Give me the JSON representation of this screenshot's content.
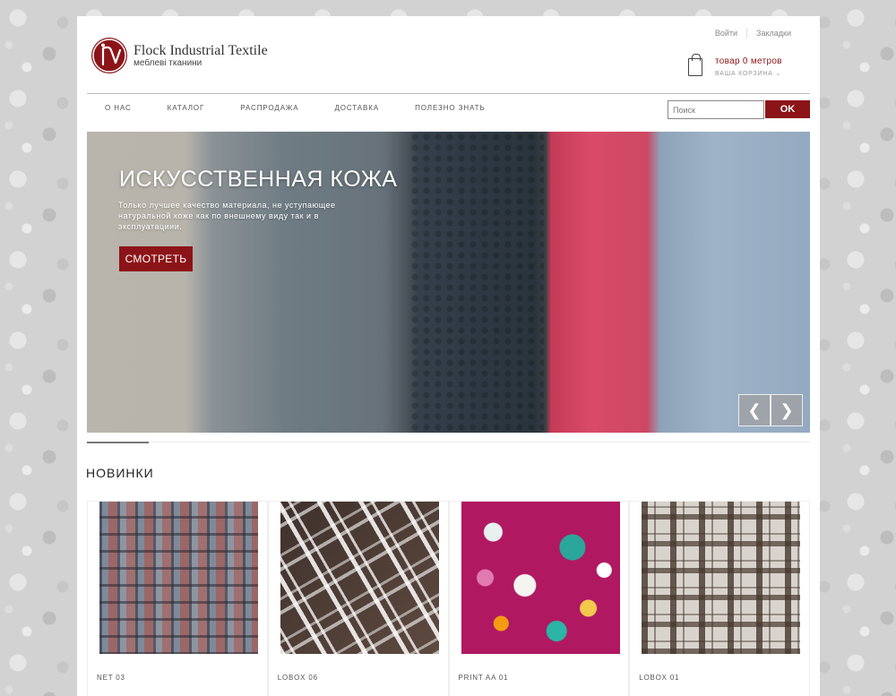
{
  "header": {
    "brand_name": "Flock Industrial Textile",
    "brand_sub": "меблеві тканини",
    "top_links": [
      "Войти",
      "Закладки"
    ],
    "cart": {
      "title": "товар 0 метров",
      "subtitle": "ВАША КОРЗИНА"
    }
  },
  "nav": {
    "items": [
      "О НАС",
      "КАТАЛОГ",
      "РАСПРОДАЖА",
      "ДОСТАВКА",
      "ПОЛЕЗНО ЗНАТЬ"
    ]
  },
  "search": {
    "placeholder": "Поиск",
    "button": "OK"
  },
  "banner": {
    "title": "ИСКУССТВЕННАЯ КОЖА",
    "text": "Только лучшее качество материала, не уступающее натуральной коже как по внешнему виду так и в эксплуатациии.",
    "button": "СМОТРЕТЬ"
  },
  "section": {
    "title": "НОВИНКИ"
  },
  "products": [
    {
      "name": "NET 03"
    },
    {
      "name": "LOBOX 06"
    },
    {
      "name": "PRINT AA 01"
    },
    {
      "name": "LOBOX 01"
    }
  ],
  "colors": {
    "accent": "#8c1418"
  }
}
